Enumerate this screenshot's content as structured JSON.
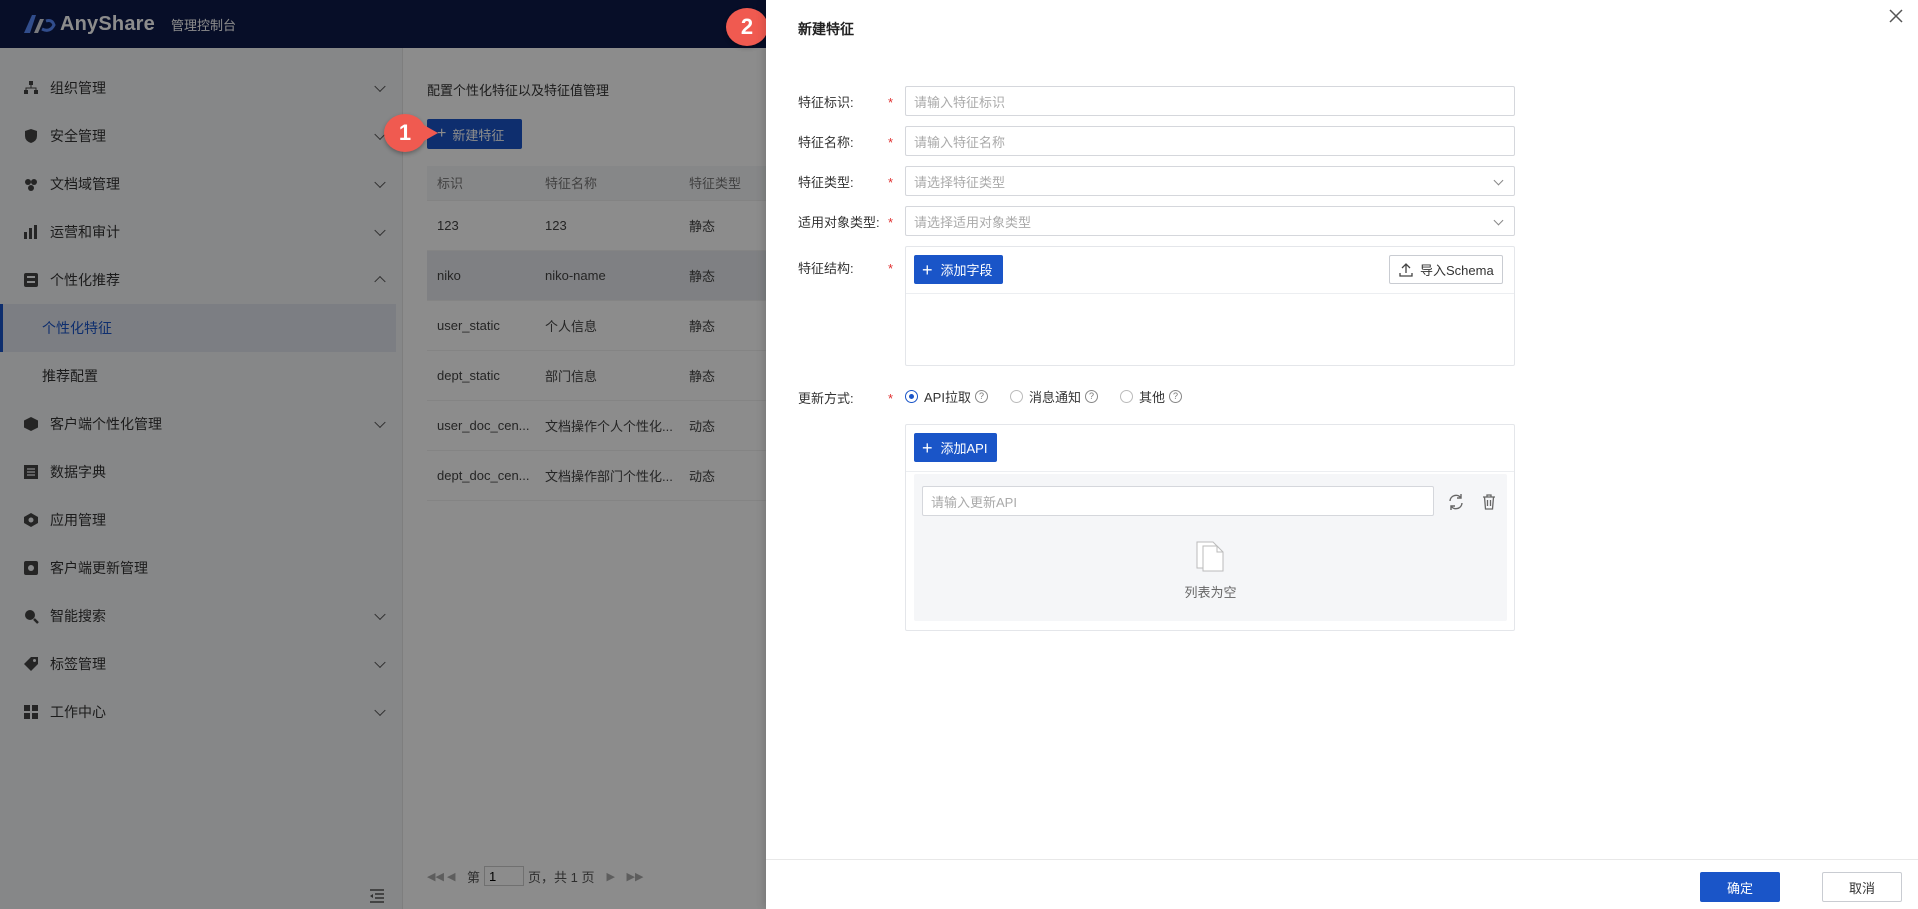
{
  "app": {
    "brand": "AnyShare",
    "console_label": "管理控制台"
  },
  "sidebar": {
    "items": [
      {
        "label": "组织管理",
        "icon": "org-icon",
        "expandable": true
      },
      {
        "label": "安全管理",
        "icon": "shield-icon",
        "expandable": true
      },
      {
        "label": "文档域管理",
        "icon": "doc-domain-icon",
        "expandable": true
      },
      {
        "label": "运营和审计",
        "icon": "bar-chart-icon",
        "expandable": true
      },
      {
        "label": "个性化推荐",
        "icon": "recommend-icon",
        "expandable": true,
        "expanded": true,
        "children": [
          {
            "label": "个性化特征",
            "active": true
          },
          {
            "label": "推荐配置"
          }
        ]
      },
      {
        "label": "客户端个性化管理",
        "icon": "cube-icon",
        "expandable": true
      },
      {
        "label": "数据字典",
        "icon": "dictionary-icon",
        "expandable": false
      },
      {
        "label": "应用管理",
        "icon": "app-icon",
        "expandable": false
      },
      {
        "label": "客户端更新管理",
        "icon": "update-icon",
        "expandable": false
      },
      {
        "label": "智能搜索",
        "icon": "search-icon",
        "expandable": true
      },
      {
        "label": "标签管理",
        "icon": "tag-icon",
        "expandable": true
      },
      {
        "label": "工作中心",
        "icon": "grid-icon",
        "expandable": true
      }
    ]
  },
  "main": {
    "description": "配置个性化特征以及特征值管理",
    "new_button": "新建特征",
    "table": {
      "headers": [
        "标识",
        "特征名称",
        "特征类型"
      ],
      "rows": [
        [
          "123",
          "123",
          "静态"
        ],
        [
          "niko",
          "niko-name",
          "静态"
        ],
        [
          "user_static",
          "个人信息",
          "静态"
        ],
        [
          "dept_static",
          "部门信息",
          "静态"
        ],
        [
          "user_doc_cen...",
          "文档操作个人个性化...",
          "动态"
        ],
        [
          "dept_doc_cen...",
          "文档操作部门个性化...",
          "动态"
        ]
      ]
    },
    "pager": {
      "prefix": "第",
      "page": "1",
      "suffix": "页，共 1 页"
    }
  },
  "badges": {
    "one": "1",
    "two": "2"
  },
  "drawer": {
    "title": "新建特征",
    "fields": {
      "id_label": "特征标识:",
      "id_placeholder": "请输入特征标识",
      "name_label": "特征名称:",
      "name_placeholder": "请输入特征名称",
      "type_label": "特征类型:",
      "type_placeholder": "请选择特征类型",
      "object_label": "适用对象类型:",
      "object_placeholder": "请选择适用对象类型",
      "structure_label": "特征结构:",
      "add_field": "添加字段",
      "import_schema": "导入Schema",
      "update_label": "更新方式:",
      "radio_api": "API拉取",
      "radio_msg": "消息通知",
      "radio_other": "其他",
      "add_api": "添加API",
      "api_placeholder": "请输入更新API",
      "empty_text": "列表为空"
    },
    "ok": "确定",
    "cancel": "取消"
  },
  "colors": {
    "primary": "#1a55c8",
    "topbar": "#0d1a4a",
    "badge": "#f05a50",
    "required": "#e03030"
  }
}
